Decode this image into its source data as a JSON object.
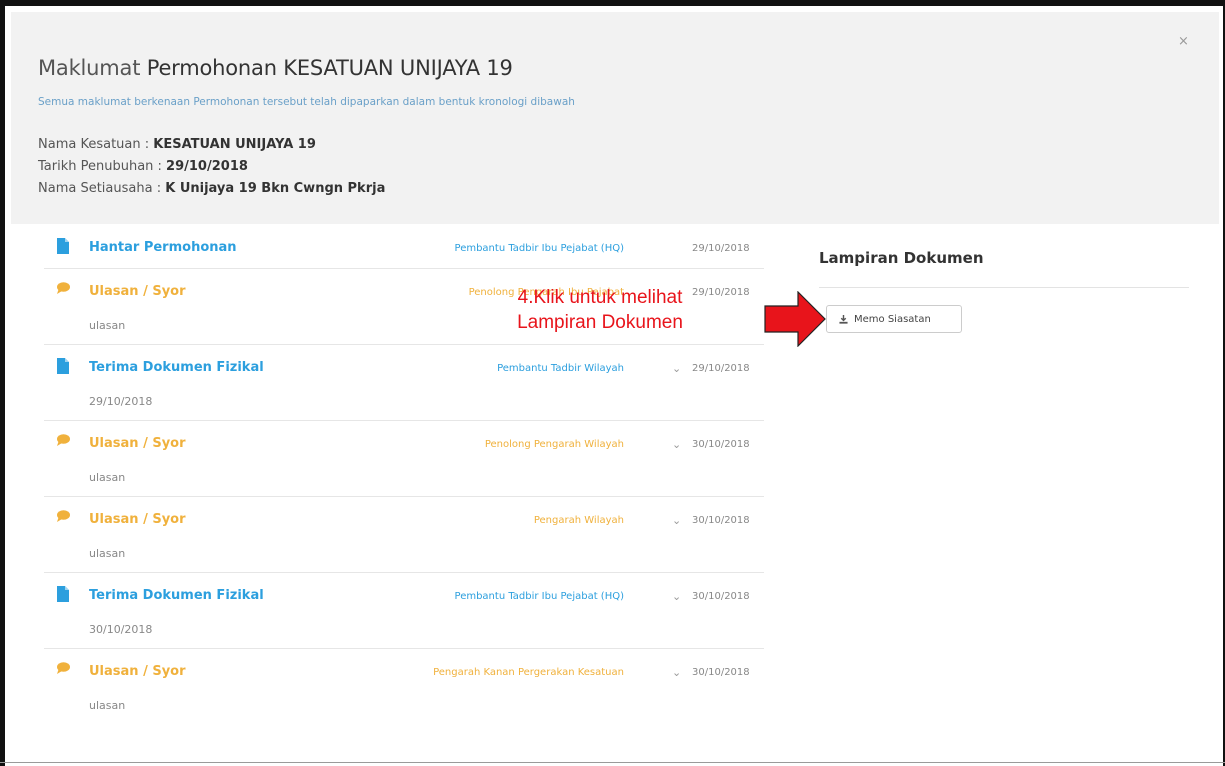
{
  "modal": {
    "close_label": "×",
    "title_prefix": "Maklumat",
    "title_main": "Permohonan KESATUAN UNIJAYA 19",
    "subtitle": "Semua maklumat berkenaan Permohonan tersebut telah dipaparkan dalam bentuk kronologi dibawah",
    "meta": [
      {
        "label": "Nama Kesatuan : ",
        "value": "KESATUAN UNIJAYA 19"
      },
      {
        "label": "Tarikh Penubuhan : ",
        "value": "29/10/2018"
      },
      {
        "label": "Nama Setiausaha : ",
        "value": "K Unijaya 19 Bkn Cwngn Pkrja"
      }
    ]
  },
  "timeline": [
    {
      "title": "Hantar Permohonan",
      "sub": "",
      "role": "Pembantu Tadbir Ibu Pejabat (HQ)",
      "chevron": "",
      "date": "29/10/2018",
      "color": "#2c9fde",
      "icon": "document-icon"
    },
    {
      "title": "Ulasan / Syor",
      "sub": "ulasan",
      "role": "Penolong Pengarah Ibu Pejabat",
      "chevron": "",
      "date": "29/10/2018",
      "color": "#f0b13c",
      "icon": "comment-icon"
    },
    {
      "title": "Terima Dokumen Fizikal",
      "sub": "29/10/2018",
      "role": "Pembantu Tadbir Wilayah",
      "chevron": "⌄",
      "date": "29/10/2018",
      "color": "#2c9fde",
      "icon": "document-icon"
    },
    {
      "title": "Ulasan / Syor",
      "sub": "ulasan",
      "role": "Penolong Pengarah Wilayah",
      "chevron": "⌄",
      "date": "30/10/2018",
      "color": "#f0b13c",
      "icon": "comment-icon"
    },
    {
      "title": "Ulasan / Syor",
      "sub": "ulasan",
      "role": "Pengarah Wilayah",
      "chevron": "⌄",
      "date": "30/10/2018",
      "color": "#f0b13c",
      "icon": "comment-icon"
    },
    {
      "title": "Terima Dokumen Fizikal",
      "sub": "30/10/2018",
      "role": "Pembantu Tadbir Ibu Pejabat (HQ)",
      "chevron": "⌄",
      "date": "30/10/2018",
      "color": "#2c9fde",
      "icon": "document-icon"
    },
    {
      "title": "Ulasan / Syor",
      "sub": "ulasan",
      "role": "Pengarah Kanan Pergerakan Kesatuan",
      "chevron": "⌄",
      "date": "30/10/2018",
      "color": "#f0b13c",
      "icon": "comment-icon"
    }
  ],
  "lampiran": {
    "title": "Lampiran Dokumen",
    "button_label": "Memo Siasatan",
    "button_icon": "download-icon"
  },
  "annotation": {
    "line1": "4.Klik untuk melihat",
    "line2": "Lampiran Dokumen",
    "color": "#e8141b"
  }
}
